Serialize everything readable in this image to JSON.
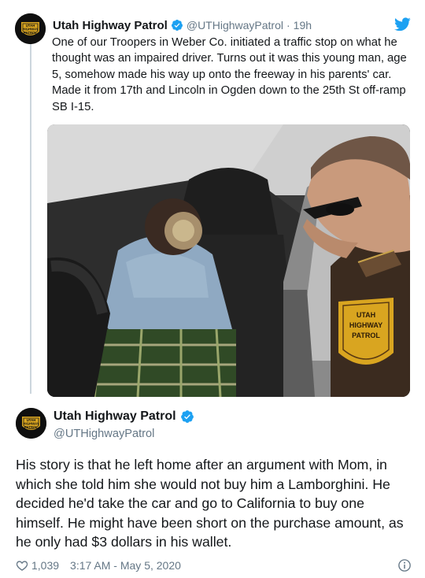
{
  "tweet1": {
    "author_name": "Utah Highway Patrol",
    "handle": "@UTHighwayPatrol",
    "separator": "·",
    "time": "19h",
    "text": "One of our Troopers in Weber Co. initiated a traffic stop on what he thought was an impaired driver. Turns out it was this young man, age 5, somehow made his way up onto the freeway in his parents' car. Made it from 17th and Lincoln in Ogden down to the 25th St off-ramp SB I-15.",
    "avatar_text": [
      "UTAH",
      "HIGHWAY",
      "PATROL"
    ],
    "photo_patch_text": [
      "UTAH",
      "HIGHWAY",
      "PATROL"
    ]
  },
  "tweet2": {
    "author_name": "Utah Highway Patrol",
    "handle": "@UTHighwayPatrol",
    "text": "His story is that he left home after an argument with Mom, in which she told him she would not buy him a Lamborghini. He decided he'd take the car and go to California to buy one himself. He might have been short on the purchase amount, as he only had $3 dollars in his wallet.",
    "likes": "1,039",
    "timestamp": "3:17 AM - May 5, 2020",
    "avatar_text": [
      "UTAH",
      "HIGHWAY",
      "PATROL"
    ]
  },
  "icons": {
    "verified": "verified-badge-icon",
    "twitter": "twitter-bird-icon",
    "like": "heart-icon",
    "info": "info-icon"
  },
  "colors": {
    "verified_blue": "#1da1f2",
    "text_primary": "#14171a",
    "text_secondary": "#657786",
    "thread_line": "#ccd6dd",
    "avatar_gold": "#d9a520"
  }
}
